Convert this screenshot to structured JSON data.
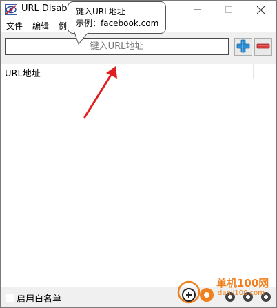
{
  "window": {
    "title": "URL Disabler"
  },
  "menu": [
    {
      "label": "文件"
    },
    {
      "label": "编辑"
    },
    {
      "label": "例"
    }
  ],
  "toolbar": {
    "url_placeholder": "键入URL地址",
    "url_value": "",
    "add_icon": "plus-icon",
    "remove_icon": "minus-icon"
  },
  "list": {
    "column_header": "URL地址",
    "items": []
  },
  "statusbar": {
    "whitelist_label": "启用白名单",
    "whitelist_checked": false
  },
  "tooltip": {
    "line1": "键入URL地址",
    "line2": "示例：facebook.com"
  },
  "watermark": {
    "text": "单机100网",
    "url": "danji100.com"
  },
  "colors": {
    "add_button": "#2b8fd6",
    "remove_button": "#d43b3b",
    "annotation_arrow": "#e02020",
    "watermark": "#f07f1e"
  }
}
